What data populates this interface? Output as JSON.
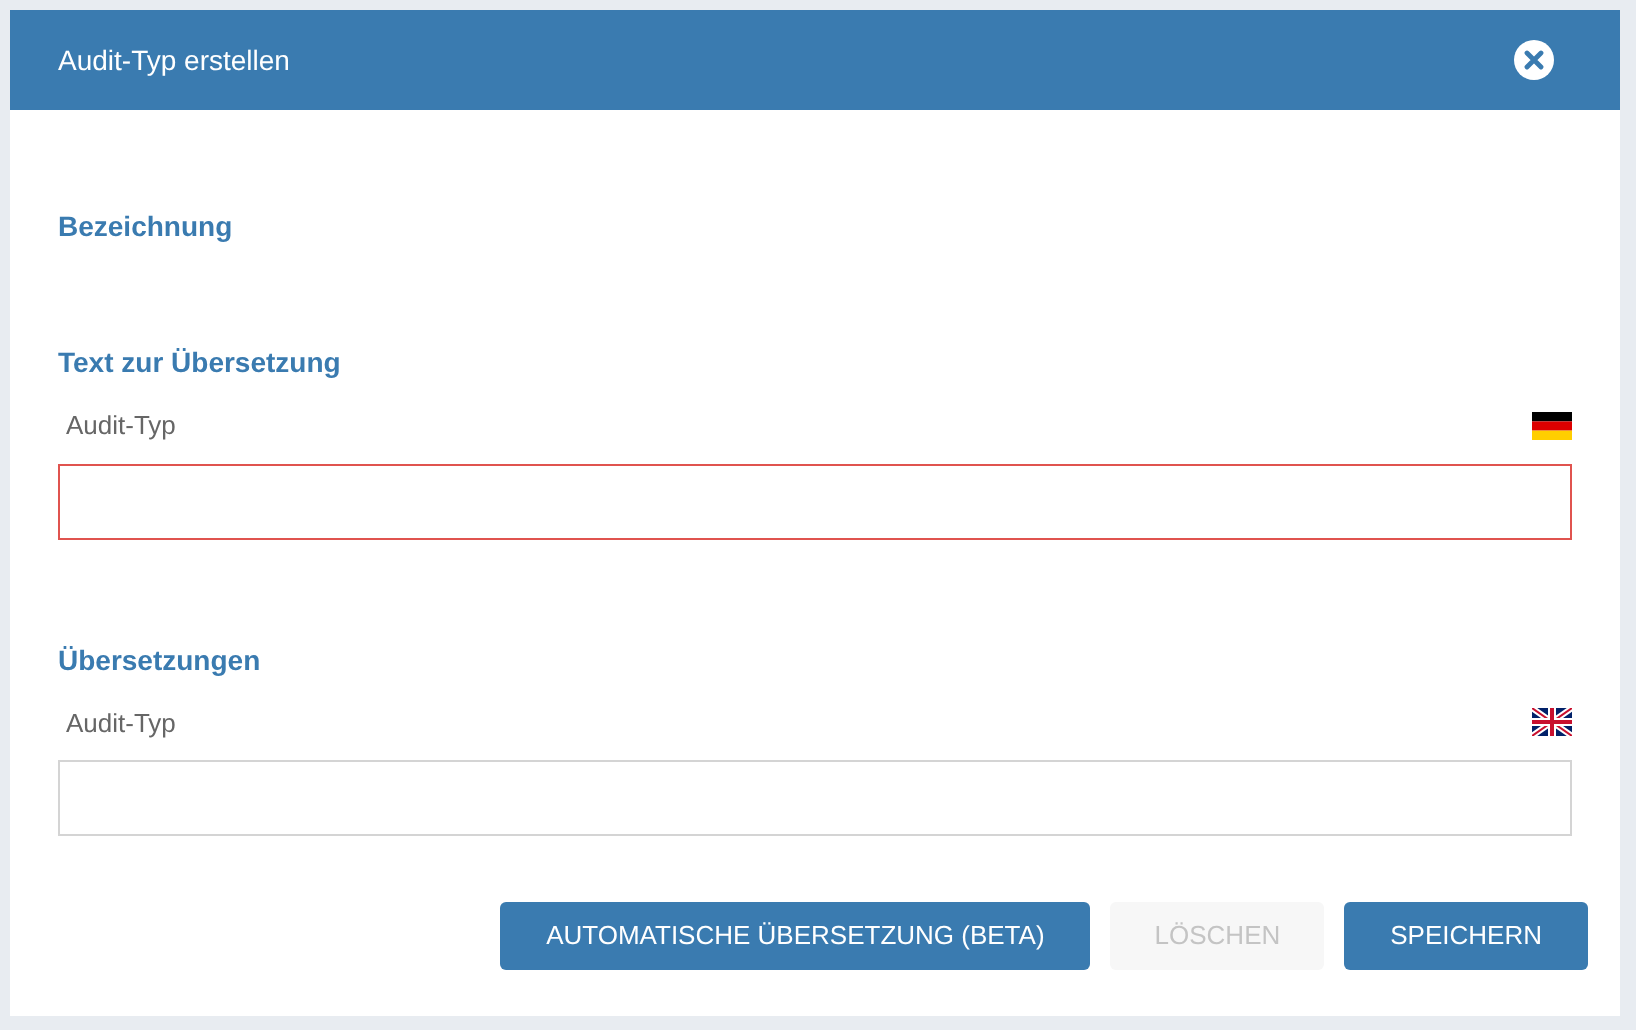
{
  "dialog": {
    "title": "Audit-Typ erstellen"
  },
  "sections": [
    {
      "heading": "Bezeichnung"
    },
    {
      "heading": "Text zur Übersetzung",
      "fields": [
        {
          "label": "Audit-Typ",
          "kind": "de",
          "invalid": true
        }
      ]
    },
    {
      "heading": "Übersetzungen",
      "fields": [
        {
          "label": "Audit-Typ",
          "kind": "gb",
          "invalid": false
        }
      ]
    }
  ],
  "buttons": [
    {
      "label": "AUTOMATISCHE ÜBERSETZUNG (BETA)",
      "disabled": false
    },
    {
      "label": "LÖSCHEN",
      "disabled": true
    },
    {
      "label": "SPEICHERN",
      "disabled": false
    }
  ]
}
